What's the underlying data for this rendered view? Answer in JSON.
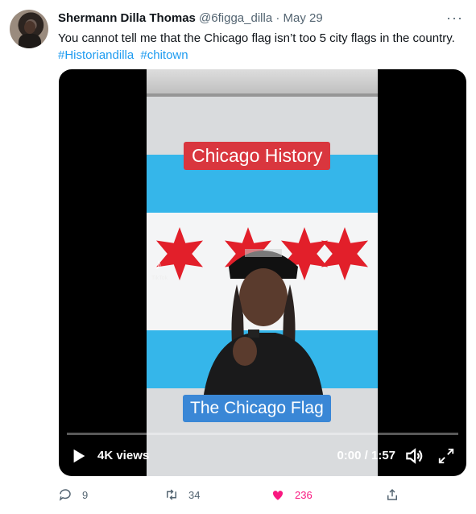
{
  "tweet": {
    "name": "Shermann Dilla Thomas",
    "handle": "@6figga_dilla",
    "separator": "·",
    "date": "May 29",
    "more": "···",
    "text": "You cannot tell me that the Chicago flag isn’t too 5 city flags in the country.",
    "hashtags": [
      "#Historiandilla",
      "#chitown"
    ]
  },
  "video": {
    "title_top": "Chicago History",
    "title_bottom": "The Chicago Flag",
    "watermark": "TikTok",
    "views": "4K views",
    "time": "0:00 / 1:57",
    "progress": 0
  },
  "actions": {
    "replies": "9",
    "retweets": "34",
    "likes": "236"
  },
  "colors": {
    "accent": "#1d9bf0",
    "like": "#f91880",
    "flag_blue": "#35b6ea",
    "flag_red": "#e21f2a"
  }
}
